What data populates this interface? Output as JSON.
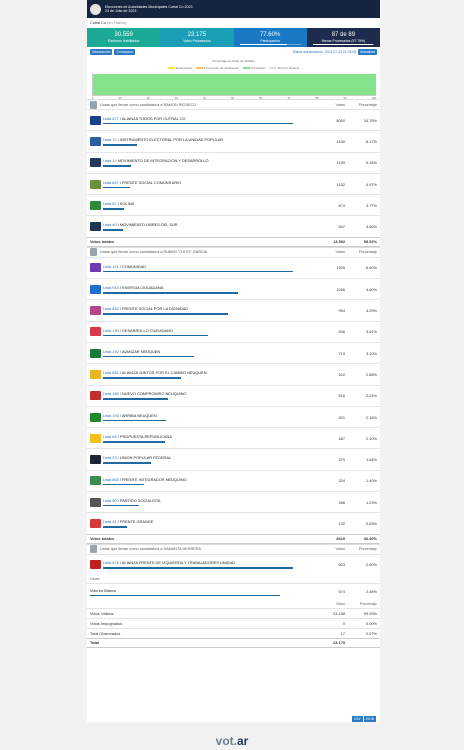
{
  "header": {
    "title": "Elecciones de Autoridades Municipales Cutral Co 2023",
    "date": "23 de Julio de 2023"
  },
  "select": {
    "value": "Cutral Co",
    "hint": "(en Fidelio)"
  },
  "summary": [
    {
      "value": "30.559",
      "label": "Electores Habilitados"
    },
    {
      "value": "23.175",
      "label": "Votos Procesados"
    },
    {
      "value": "77.60%",
      "label": "Participación",
      "fill": 0.776
    },
    {
      "value": "87 de 89",
      "label": "Mesas Procesadas (97.75%)",
      "fill": 0.9775
    }
  ],
  "buttons": {
    "intro": "Introducción",
    "concepts": "Conceptos",
    "update_label": "Última actualización: 2023-07-23 21:05:08",
    "refresh": "Actualizar"
  },
  "progress": {
    "title": "Porcentaje de Actas por Estado",
    "legend": [
      {
        "label": "En Escaneo",
        "color": "#f4e24a"
      },
      {
        "label": "En proceso de verificación",
        "color": "#f6c06a"
      },
      {
        "label": "Procesado",
        "color": "#84e38a"
      },
      {
        "label": "Sin/Con Defecto",
        "color": "#e0e0e0"
      }
    ],
    "axis": [
      "0",
      "10",
      "20",
      "30",
      "40",
      "50",
      "60",
      "70",
      "80",
      "90",
      "100"
    ]
  },
  "columns": {
    "votes": "Votos",
    "pct": "Porcentaje"
  },
  "sections": [
    {
      "title": "Listas que llevan como candidato/a a RAMON RIOSECO",
      "rows": [
        {
          "num": "Lista 677",
          "name": " / ALIANZA TODOS POR CUTRAL CO",
          "votes": "8050",
          "pct": "34.76%",
          "bar": 1.0,
          "color": "#1b3f8f"
        },
        {
          "num": "Lista 72",
          "name": " / INSTRUMENTO ELECTORAL POR LA UNIDAD POPULAR",
          "votes": "1430",
          "pct": "6.17%",
          "bar": 0.178,
          "color": "#2a5fa0"
        },
        {
          "num": "Lista 1",
          "name": " / MOVIMIENTO DE INTEGRACION Y DESARROLLO",
          "votes": "1199",
          "pct": "5.18%",
          "bar": 0.149,
          "color": "#27375e"
        },
        {
          "num": "Lista 847",
          "name": " / FRENTE SOCIAL COMUNITARIO",
          "votes": "1152",
          "pct": "4.97%",
          "bar": 0.143,
          "color": "#6b8f3a"
        },
        {
          "num": "Lista 67",
          "name": " / KOLINA",
          "votes": "874",
          "pct": "3.77%",
          "bar": 0.108,
          "color": "#2f8a3c"
        },
        {
          "num": "Lista 40",
          "name": " / MOVIMIENTO LIBRES DEL SUR",
          "votes": "847",
          "pct": "3.66%",
          "bar": 0.105,
          "color": "#1f3553"
        }
      ],
      "total_label": "Votos totales",
      "total_votes": "13.552",
      "total_pct": "58.52%"
    },
    {
      "title": "Listas que llevan como candidato/a a RUBEN \"OJITO\" GARCIA",
      "rows": [
        {
          "num": "Lista 191",
          "name": " / COMUNIDAD",
          "votes": "1505",
          "pct": "6.50%",
          "bar": 1.0,
          "color": "#6c3bb3"
        },
        {
          "num": "Lista 914",
          "name": " / ENERGIA CIUDADANA",
          "votes": "1066",
          "pct": "4.60%",
          "bar": 0.708,
          "color": "#1d6fd0"
        },
        {
          "num": "Lista 842",
          "name": " / FRENTE SOCIAL POR LA DIGNIDAD",
          "votes": "994",
          "pct": "4.29%",
          "bar": 0.66,
          "color": "#b6458a"
        },
        {
          "num": "Lista 190",
          "name": " / DESARROLLO CIUDADANO",
          "votes": "836",
          "pct": "3.61%",
          "bar": 0.555,
          "color": "#d9394a"
        },
        {
          "num": "Lista 192",
          "name": " / AVANZAR NEUQUEN",
          "votes": "719",
          "pct": "3.10%",
          "bar": 0.478,
          "color": "#1a7a3c"
        },
        {
          "num": "Lista 661",
          "name": " / ALIANZA JUNTOS POR EL CAMBIO NEUQUEN",
          "votes": "622",
          "pct": "2.68%",
          "bar": 0.413,
          "color": "#e8b61f"
        },
        {
          "num": "Lista 180",
          "name": " / NUEVO COMPROMISO NEUQUINO",
          "votes": "518",
          "pct": "2.24%",
          "bar": 0.344,
          "color": "#c22f2f"
        },
        {
          "num": "Lista 193",
          "name": " / ARRIBA NEUQUEN",
          "votes": "501",
          "pct": "2.16%",
          "bar": 0.333,
          "color": "#1e8a2d"
        },
        {
          "num": "Lista 64",
          "name": " / PROPUESTA REPUBLICANA",
          "votes": "487",
          "pct": "2.10%",
          "bar": 0.324,
          "color": "#f2c21a"
        },
        {
          "num": "Lista 23",
          "name": " / UNION POPULAR FEDERAL",
          "votes": "379",
          "pct": "1.64%",
          "bar": 0.252,
          "color": "#1d2434"
        },
        {
          "num": "Lista 863",
          "name": " / FRENTE INTEGRADOR NEUQUINO",
          "votes": "324",
          "pct": "1.40%",
          "bar": 0.215,
          "color": "#3d8a52"
        },
        {
          "num": "Lista 50",
          "name": " / PARTIDO SOCIALISTA",
          "votes": "286",
          "pct": "1.23%",
          "bar": 0.19,
          "color": "#555"
        },
        {
          "num": "Lista 41",
          "name": " / FRENTE GRANDE",
          "votes": "192",
          "pct": "0.83%",
          "bar": 0.128,
          "color": "#d53a3a"
        }
      ],
      "total_label": "Votos totales",
      "total_votes": "8429",
      "total_pct": "36.40%"
    },
    {
      "title": "Listas que llevan como candidato/a a SAMANTA HERRERA",
      "rows": [
        {
          "num": "Lista 678",
          "name": " / ALIANZA FRENTE DE IZQUIERDA Y TRABAJADORES UNIDAD",
          "votes": "603",
          "pct": "2.60%",
          "bar": 1.0,
          "color": "#c02020"
        }
      ]
    }
  ],
  "blank": {
    "header": "Listas",
    "label": "Voto en Blanco",
    "votes": "574",
    "pct": "2.48%",
    "bar": 1.0
  },
  "stats": {
    "col_votes": "Votos",
    "col_pct": "Porcentaje",
    "rows": [
      {
        "label": "Votos Válidos",
        "votes": "23.158",
        "pct": "99.93%"
      },
      {
        "label": "Votos Impugnados",
        "votes": "0",
        "pct": "0.00%"
      },
      {
        "label": "Total Observados",
        "votes": "17",
        "pct": "0.07%"
      }
    ],
    "total_label": "Total",
    "total_votes": "23.175"
  },
  "exports": [
    "CSV",
    "JSON"
  ],
  "brand": {
    "a": "vot.",
    "b": "ar"
  }
}
